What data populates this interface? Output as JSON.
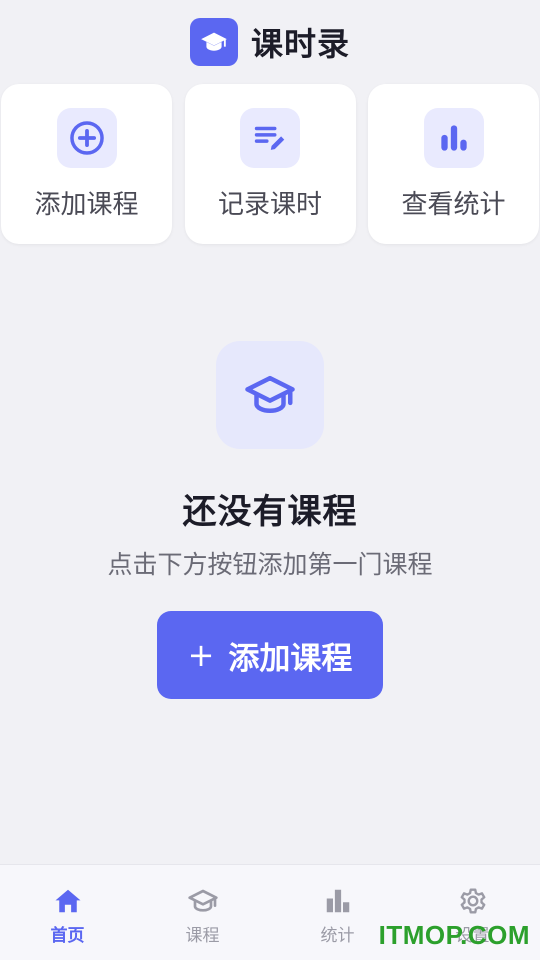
{
  "header": {
    "title": "课时录",
    "logo_icon": "graduation-cap-icon"
  },
  "quick_actions": [
    {
      "label": "添加课程",
      "icon": "add-circle-icon"
    },
    {
      "label": "记录课时",
      "icon": "edit-list-icon"
    },
    {
      "label": "查看统计",
      "icon": "bar-chart-icon"
    }
  ],
  "empty_state": {
    "icon": "graduation-cap-icon",
    "title": "还没有课程",
    "subtitle": "点击下方按钮添加第一门课程",
    "button_icon": "+",
    "button_label": "添加课程"
  },
  "tabbar": {
    "items": [
      {
        "label": "首页",
        "icon": "home-icon",
        "active": true
      },
      {
        "label": "课程",
        "icon": "graduation-cap-icon",
        "active": false
      },
      {
        "label": "统计",
        "icon": "bar-chart-icon",
        "active": false
      },
      {
        "label": "设置",
        "icon": "gear-icon",
        "active": false
      }
    ]
  },
  "watermark": "ITMOP.COM",
  "colors": {
    "accent": "#5b67f1",
    "accent_light": "#e9eafe",
    "background": "#f1f1f5",
    "inactive": "#9b9ba6",
    "watermark": "#2ca02c"
  }
}
